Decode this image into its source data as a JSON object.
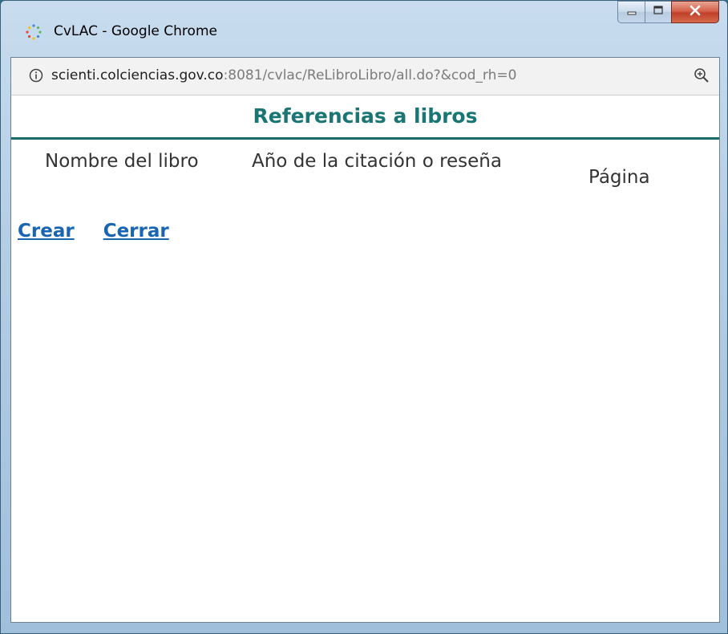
{
  "window": {
    "title": "CvLAC - Google Chrome",
    "app_icon": "chrome-loading-spinner-icon"
  },
  "address_bar": {
    "url_host": "scienti.colciencias.gov.co",
    "url_path": ":8081/cvlac/ReLibroLibro/all.do?&cod_rh=0",
    "info_icon": "info-icon",
    "zoom_icon": "zoom-icon"
  },
  "page": {
    "heading": "Referencias a libros",
    "columns": {
      "book_name": "Nombre del libro",
      "citation_year": "Año de la citación o reseña",
      "page": "Página"
    },
    "links": {
      "create": "Crear",
      "close": "Cerrar"
    }
  },
  "colors": {
    "heading": "#1a7575",
    "link": "#1866b3",
    "close_button": "#c0402a"
  }
}
